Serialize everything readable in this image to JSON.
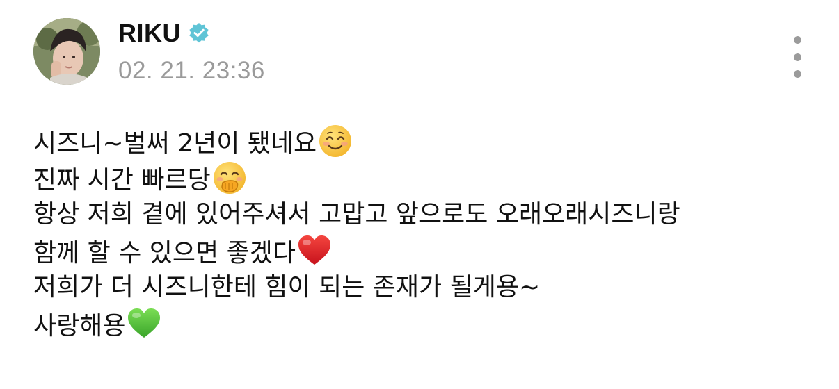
{
  "post": {
    "author": "RIKU",
    "verified_icon": "verified-badge-icon",
    "timestamp": "02. 21. 23:36",
    "more_icon": "more-vertical-icon",
    "lines": [
      {
        "text": "시즈니~벌써 2년이 됐네요",
        "emoji": "smiling-face-icon"
      },
      {
        "text": "진짜 시간 빠르당",
        "emoji": "hand-over-mouth-icon"
      },
      {
        "text": "항상 저희 곁에 있어주셔서 고맙고 앞으로도 오래오래시즈니랑",
        "emoji": ""
      },
      {
        "text": "함께 할 수 있으면 좋겠다",
        "emoji": "red-heart-icon"
      },
      {
        "text": "저희가 더 시즈니한테 힘이 되는 존재가 될게용~",
        "emoji": ""
      },
      {
        "text": "사랑해용",
        "emoji": "green-heart-icon"
      }
    ]
  },
  "colors": {
    "verified": "#5fc4d6",
    "timestamp": "#9a9a9a",
    "red_heart": "#e0262f",
    "green_heart": "#5fc93e",
    "emoji_yellow": "#f8c43a"
  }
}
